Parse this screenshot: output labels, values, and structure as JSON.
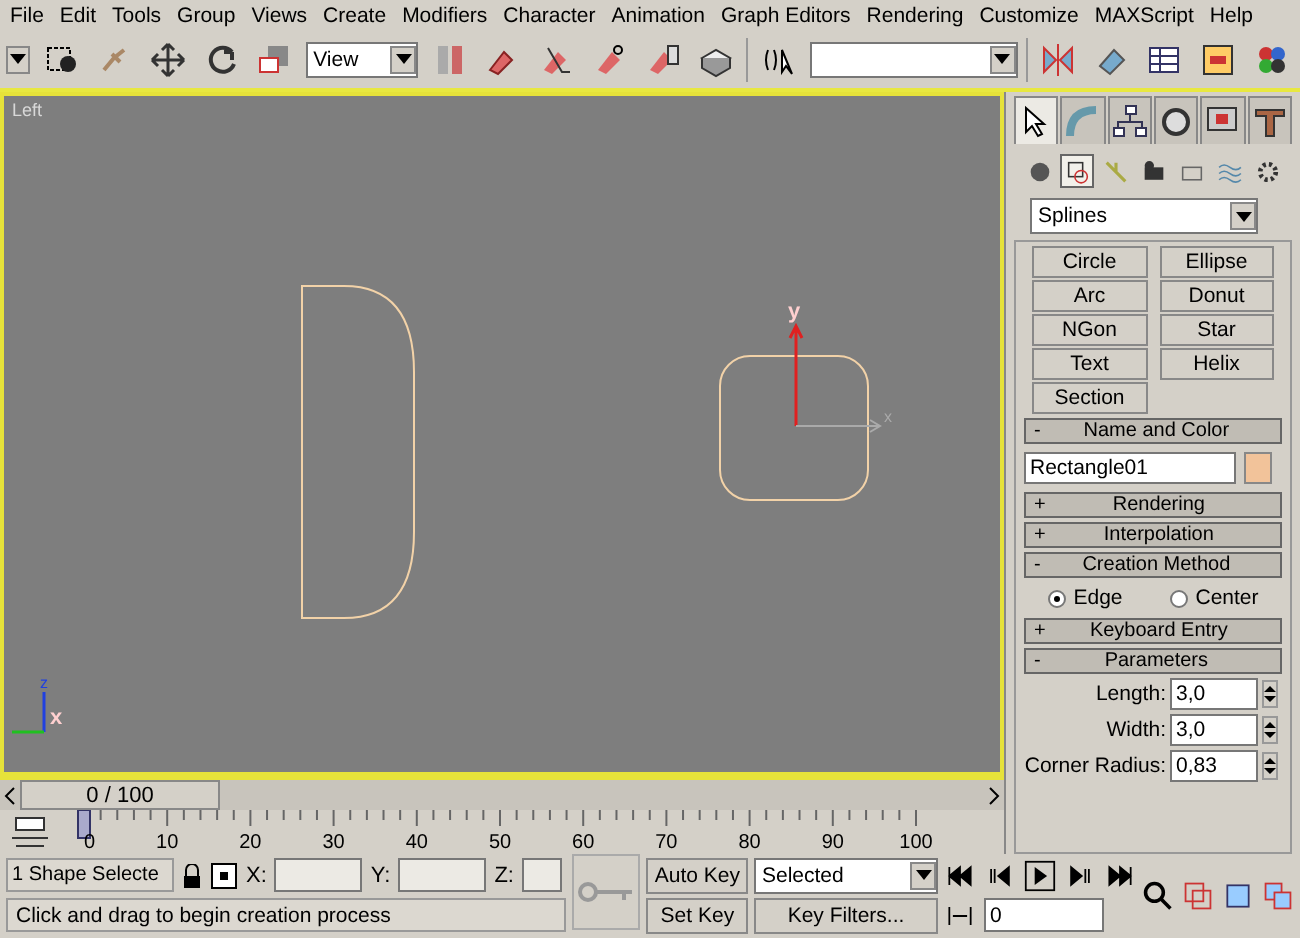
{
  "menu": [
    "File",
    "Edit",
    "Tools",
    "Group",
    "Views",
    "Create",
    "Modifiers",
    "Character",
    "Animation",
    "Graph Editors",
    "Rendering",
    "Customize",
    "MAXScript",
    "Help"
  ],
  "toolbar": {
    "reference_coord": "View"
  },
  "viewport": {
    "label": "Left",
    "gizmo_axes": [
      "y",
      "x"
    ],
    "tripod_axes": [
      "z",
      "x"
    ]
  },
  "command_panel": {
    "tabs": [
      {
        "selected": true
      },
      {
        "selected": false
      },
      {
        "selected": false
      },
      {
        "selected": false
      },
      {
        "selected": false
      },
      {
        "selected": false
      }
    ],
    "categories": [
      {
        "selected": false
      },
      {
        "selected": true
      },
      {
        "selected": false
      },
      {
        "selected": false
      },
      {
        "selected": false
      },
      {
        "selected": false
      },
      {
        "selected": false
      }
    ],
    "dropdown": "Splines",
    "object_types": [
      "Circle",
      "Ellipse",
      "Arc",
      "Donut",
      "NGon",
      "Star",
      "Text",
      "Helix",
      "Section"
    ],
    "rollouts": [
      {
        "sign": "-",
        "title": "Name and Color",
        "kind": "name",
        "name": "Rectangle01",
        "color": "#f2c39a"
      },
      {
        "sign": "+",
        "title": "Rendering",
        "kind": "collapsed"
      },
      {
        "sign": "+",
        "title": "Interpolation",
        "kind": "collapsed"
      },
      {
        "sign": "-",
        "title": "Creation Method",
        "kind": "radio",
        "options": [
          {
            "label": "Edge",
            "selected": true
          },
          {
            "label": "Center",
            "selected": false
          }
        ]
      },
      {
        "sign": "+",
        "title": "Keyboard Entry",
        "kind": "collapsed"
      },
      {
        "sign": "-",
        "title": "Parameters",
        "kind": "fields",
        "fields": [
          {
            "label": "Length:",
            "value": "3,0"
          },
          {
            "label": "Width:",
            "value": "3,0"
          },
          {
            "label": "Corner Radius:",
            "value": "0,83"
          }
        ]
      }
    ]
  },
  "time_slider": {
    "frame": "0 / 100",
    "level": 0
  },
  "track_bar": {
    "ticks": [
      "0",
      "10",
      "20",
      "30",
      "40",
      "50",
      "60",
      "70",
      "80",
      "90",
      "100"
    ]
  },
  "status": {
    "selection": "1 Shape Selecte",
    "x_label": "X:",
    "y_label": "Y:",
    "z_label": "Z:",
    "prompt": "Click and drag to begin creation process",
    "auto_key": "Auto Key",
    "set_key": "Set Key",
    "key_mode": "Selected",
    "key_filters": "Key Filters...",
    "current_frame": "0"
  }
}
